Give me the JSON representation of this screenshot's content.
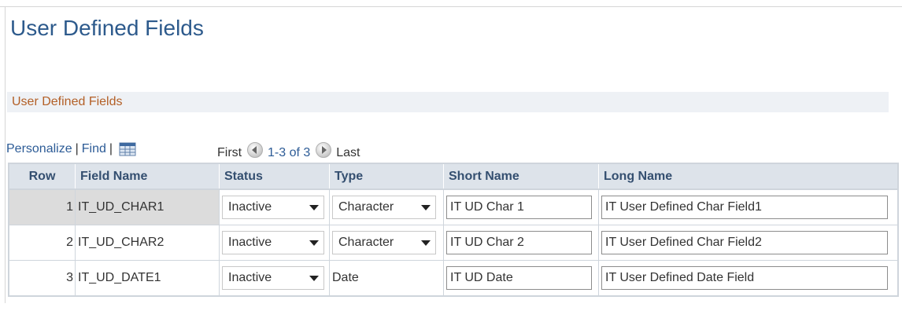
{
  "page": {
    "title": "User Defined Fields"
  },
  "section": {
    "title": "User Defined Fields"
  },
  "nav": {
    "personalize": "Personalize",
    "sep": "|",
    "find": "Find"
  },
  "pager": {
    "first": "First",
    "count": "1-3 of 3",
    "last": "Last"
  },
  "table": {
    "headers": [
      "Row",
      "Field Name",
      "Status",
      "Type",
      "Short Name",
      "Long Name"
    ],
    "rows": [
      {
        "row": "1",
        "field_name": "IT_UD_CHAR1",
        "status": "Inactive",
        "type": "Character",
        "short_name": "IT UD Char 1",
        "long_name": "IT User Defined Char Field1"
      },
      {
        "row": "2",
        "field_name": "IT_UD_CHAR2",
        "status": "Inactive",
        "type": "Character",
        "short_name": "IT UD Char 2",
        "long_name": "IT User Defined Char Field2"
      },
      {
        "row": "3",
        "field_name": "IT_UD_DATE1",
        "status": "Inactive",
        "type": "Date",
        "short_name": "IT UD Date",
        "long_name": "IT User Defined Date Field"
      }
    ]
  },
  "icons": {
    "grid": "view-all-grid-icon",
    "prev": "previous-arrow-icon",
    "next": "next-arrow-icon",
    "dropdown": "chevron-down-icon"
  },
  "colors": {
    "title": "#2d5a8c",
    "section_title": "#b35f26",
    "link": "#2c5b96",
    "header_bg": "#dde3ea",
    "selected_row_bg": "#dcdcdc"
  }
}
